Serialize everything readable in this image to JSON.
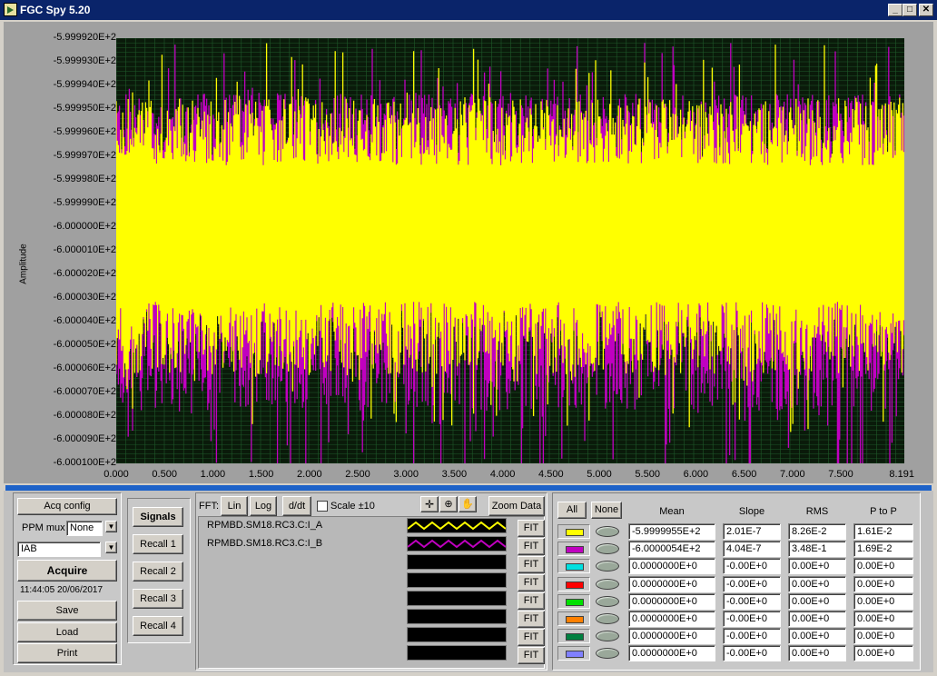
{
  "window": {
    "title": "FGC Spy 5.20",
    "min_label": "_",
    "max_label": "□",
    "close_label": "✕"
  },
  "plot": {
    "ylabel": "Amplitude",
    "yticks": [
      "-5.999920E+2",
      "-5.999930E+2",
      "-5.999940E+2",
      "-5.999950E+2",
      "-5.999960E+2",
      "-5.999970E+2",
      "-5.999980E+2",
      "-5.999990E+2",
      "-6.000000E+2",
      "-6.000010E+2",
      "-6.000020E+2",
      "-6.000030E+2",
      "-6.000040E+2",
      "-6.000050E+2",
      "-6.000060E+2",
      "-6.000070E+2",
      "-6.000080E+2",
      "-6.000090E+2",
      "-6.000100E+2"
    ],
    "xticks": [
      "0.000",
      "0.500",
      "1.000",
      "1.500",
      "2.000",
      "2.500",
      "3.000",
      "3.500",
      "4.000",
      "4.500",
      "5.000",
      "5.500",
      "6.000",
      "6.500",
      "7.000",
      "7.500",
      "8.191"
    ],
    "background": "#0a1a0a",
    "grid_color": "#1f5a2a",
    "series_colors": [
      "#ffff00",
      "#c000c0"
    ]
  },
  "acq": {
    "config_label": "Acq config",
    "ppm_label": "PPM mux",
    "ppm_value": "None",
    "signal_value": "IAB",
    "acquire_label": "Acquire",
    "timestamp": "11:44:05 20/06/2017",
    "save_label": "Save",
    "load_label": "Load",
    "print_label": "Print"
  },
  "recall": {
    "signals_label": "Signals",
    "items": [
      "Recall 1",
      "Recall 2",
      "Recall 3",
      "Recall 4"
    ]
  },
  "fft": {
    "label": "FFT:",
    "lin": "Lin",
    "log": "Log",
    "ddt": "d/dt",
    "scale": "Scale ±10",
    "zoom": "Zoom Data"
  },
  "signals": {
    "names": [
      "RPMBD.SM18.RC3.C:I_A",
      "RPMBD.SM18.RC3.C:I_B",
      "",
      "",
      "",
      "",
      "",
      ""
    ],
    "fit_label": "FIT"
  },
  "stats": {
    "all_label": "All",
    "none_label": "None",
    "headers": [
      "Mean",
      "Slope",
      "RMS",
      "P to P"
    ],
    "colors": [
      "#ffff00",
      "#c000c0",
      "#00e0e0",
      "#ff0000",
      "#00e000",
      "#ff8000",
      "#008040",
      "#8080ff"
    ],
    "rows": [
      [
        "-5.9999955E+2",
        "2.01E-7",
        "8.26E-2",
        "1.61E-2"
      ],
      [
        "-6.0000054E+2",
        "4.04E-7",
        "3.48E-1",
        "1.69E-2"
      ],
      [
        "0.0000000E+0",
        "-0.00E+0",
        "0.00E+0",
        "0.00E+0"
      ],
      [
        "0.0000000E+0",
        "-0.00E+0",
        "0.00E+0",
        "0.00E+0"
      ],
      [
        "0.0000000E+0",
        "-0.00E+0",
        "0.00E+0",
        "0.00E+0"
      ],
      [
        "0.0000000E+0",
        "-0.00E+0",
        "0.00E+0",
        "0.00E+0"
      ],
      [
        "0.0000000E+0",
        "-0.00E+0",
        "0.00E+0",
        "0.00E+0"
      ],
      [
        "0.0000000E+0",
        "-0.00E+0",
        "0.00E+0",
        "0.00E+0"
      ]
    ]
  }
}
